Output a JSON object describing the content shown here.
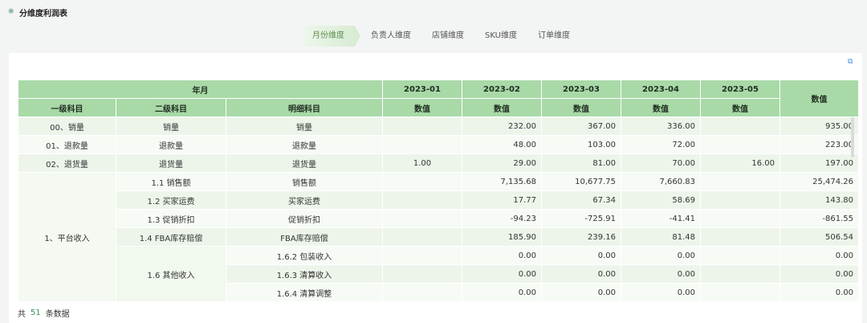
{
  "header": {
    "icon": "flower-icon",
    "title": "分维度利润表"
  },
  "tabs": [
    "月份维度",
    "负责人维度",
    "店铺维度",
    "SKU维度",
    "订单维度"
  ],
  "toolbar": {
    "export_icon": "export-icon"
  },
  "table": {
    "group_header": "年月",
    "row_headers": [
      "一级科目",
      "二级科目",
      "明细科目"
    ],
    "months": [
      "2023-01",
      "2023-02",
      "2023-03",
      "2023-04",
      "2023-05"
    ],
    "value_label": "数值",
    "total_label": "数值",
    "rows": [
      {
        "l1": "00、销量",
        "l2": "销量",
        "l3": "销量",
        "v": [
          "",
          "232.00",
          "367.00",
          "336.00",
          "",
          "935.00"
        ]
      },
      {
        "l1": "01、退款量",
        "l2": "退款量",
        "l3": "退款量",
        "v": [
          "",
          "48.00",
          "103.00",
          "72.00",
          "",
          "223.00"
        ]
      },
      {
        "l1": "02、退货量",
        "l2": "退货量",
        "l3": "退货量",
        "v": [
          "1.00",
          "29.00",
          "81.00",
          "70.00",
          "16.00",
          "197.00"
        ]
      },
      {
        "l1": "1、平台收入",
        "l2": "1.1 销售额",
        "l3": "销售额",
        "v": [
          "",
          "7,135.68",
          "10,677.75",
          "7,660.83",
          "",
          "25,474.26"
        ]
      },
      {
        "l2": "1.2 买家运费",
        "l3": "买家运费",
        "v": [
          "",
          "17.77",
          "67.34",
          "58.69",
          "",
          "143.80"
        ]
      },
      {
        "l2": "1.3 促销折扣",
        "l3": "促销折扣",
        "v": [
          "",
          "-94.23",
          "-725.91",
          "-41.41",
          "",
          "-861.55"
        ]
      },
      {
        "l2": "1.4 FBA库存赔偿",
        "l3": "FBA库存赔偿",
        "v": [
          "",
          "185.90",
          "239.16",
          "81.48",
          "",
          "506.54"
        ]
      },
      {
        "l2": "1.6 其他收入",
        "l3": "1.6.2 包装收入",
        "v": [
          "",
          "0.00",
          "0.00",
          "0.00",
          "",
          "0.00"
        ]
      },
      {
        "l3": "1.6.3 清算收入",
        "v": [
          "",
          "0.00",
          "0.00",
          "0.00",
          "",
          "0.00"
        ]
      },
      {
        "l3": "1.6.4 清算调整",
        "v": [
          "",
          "0.00",
          "0.00",
          "0.00",
          "",
          "0.00"
        ]
      }
    ]
  },
  "footer": {
    "prefix": "共",
    "count": "51",
    "suffix": "条数据"
  }
}
